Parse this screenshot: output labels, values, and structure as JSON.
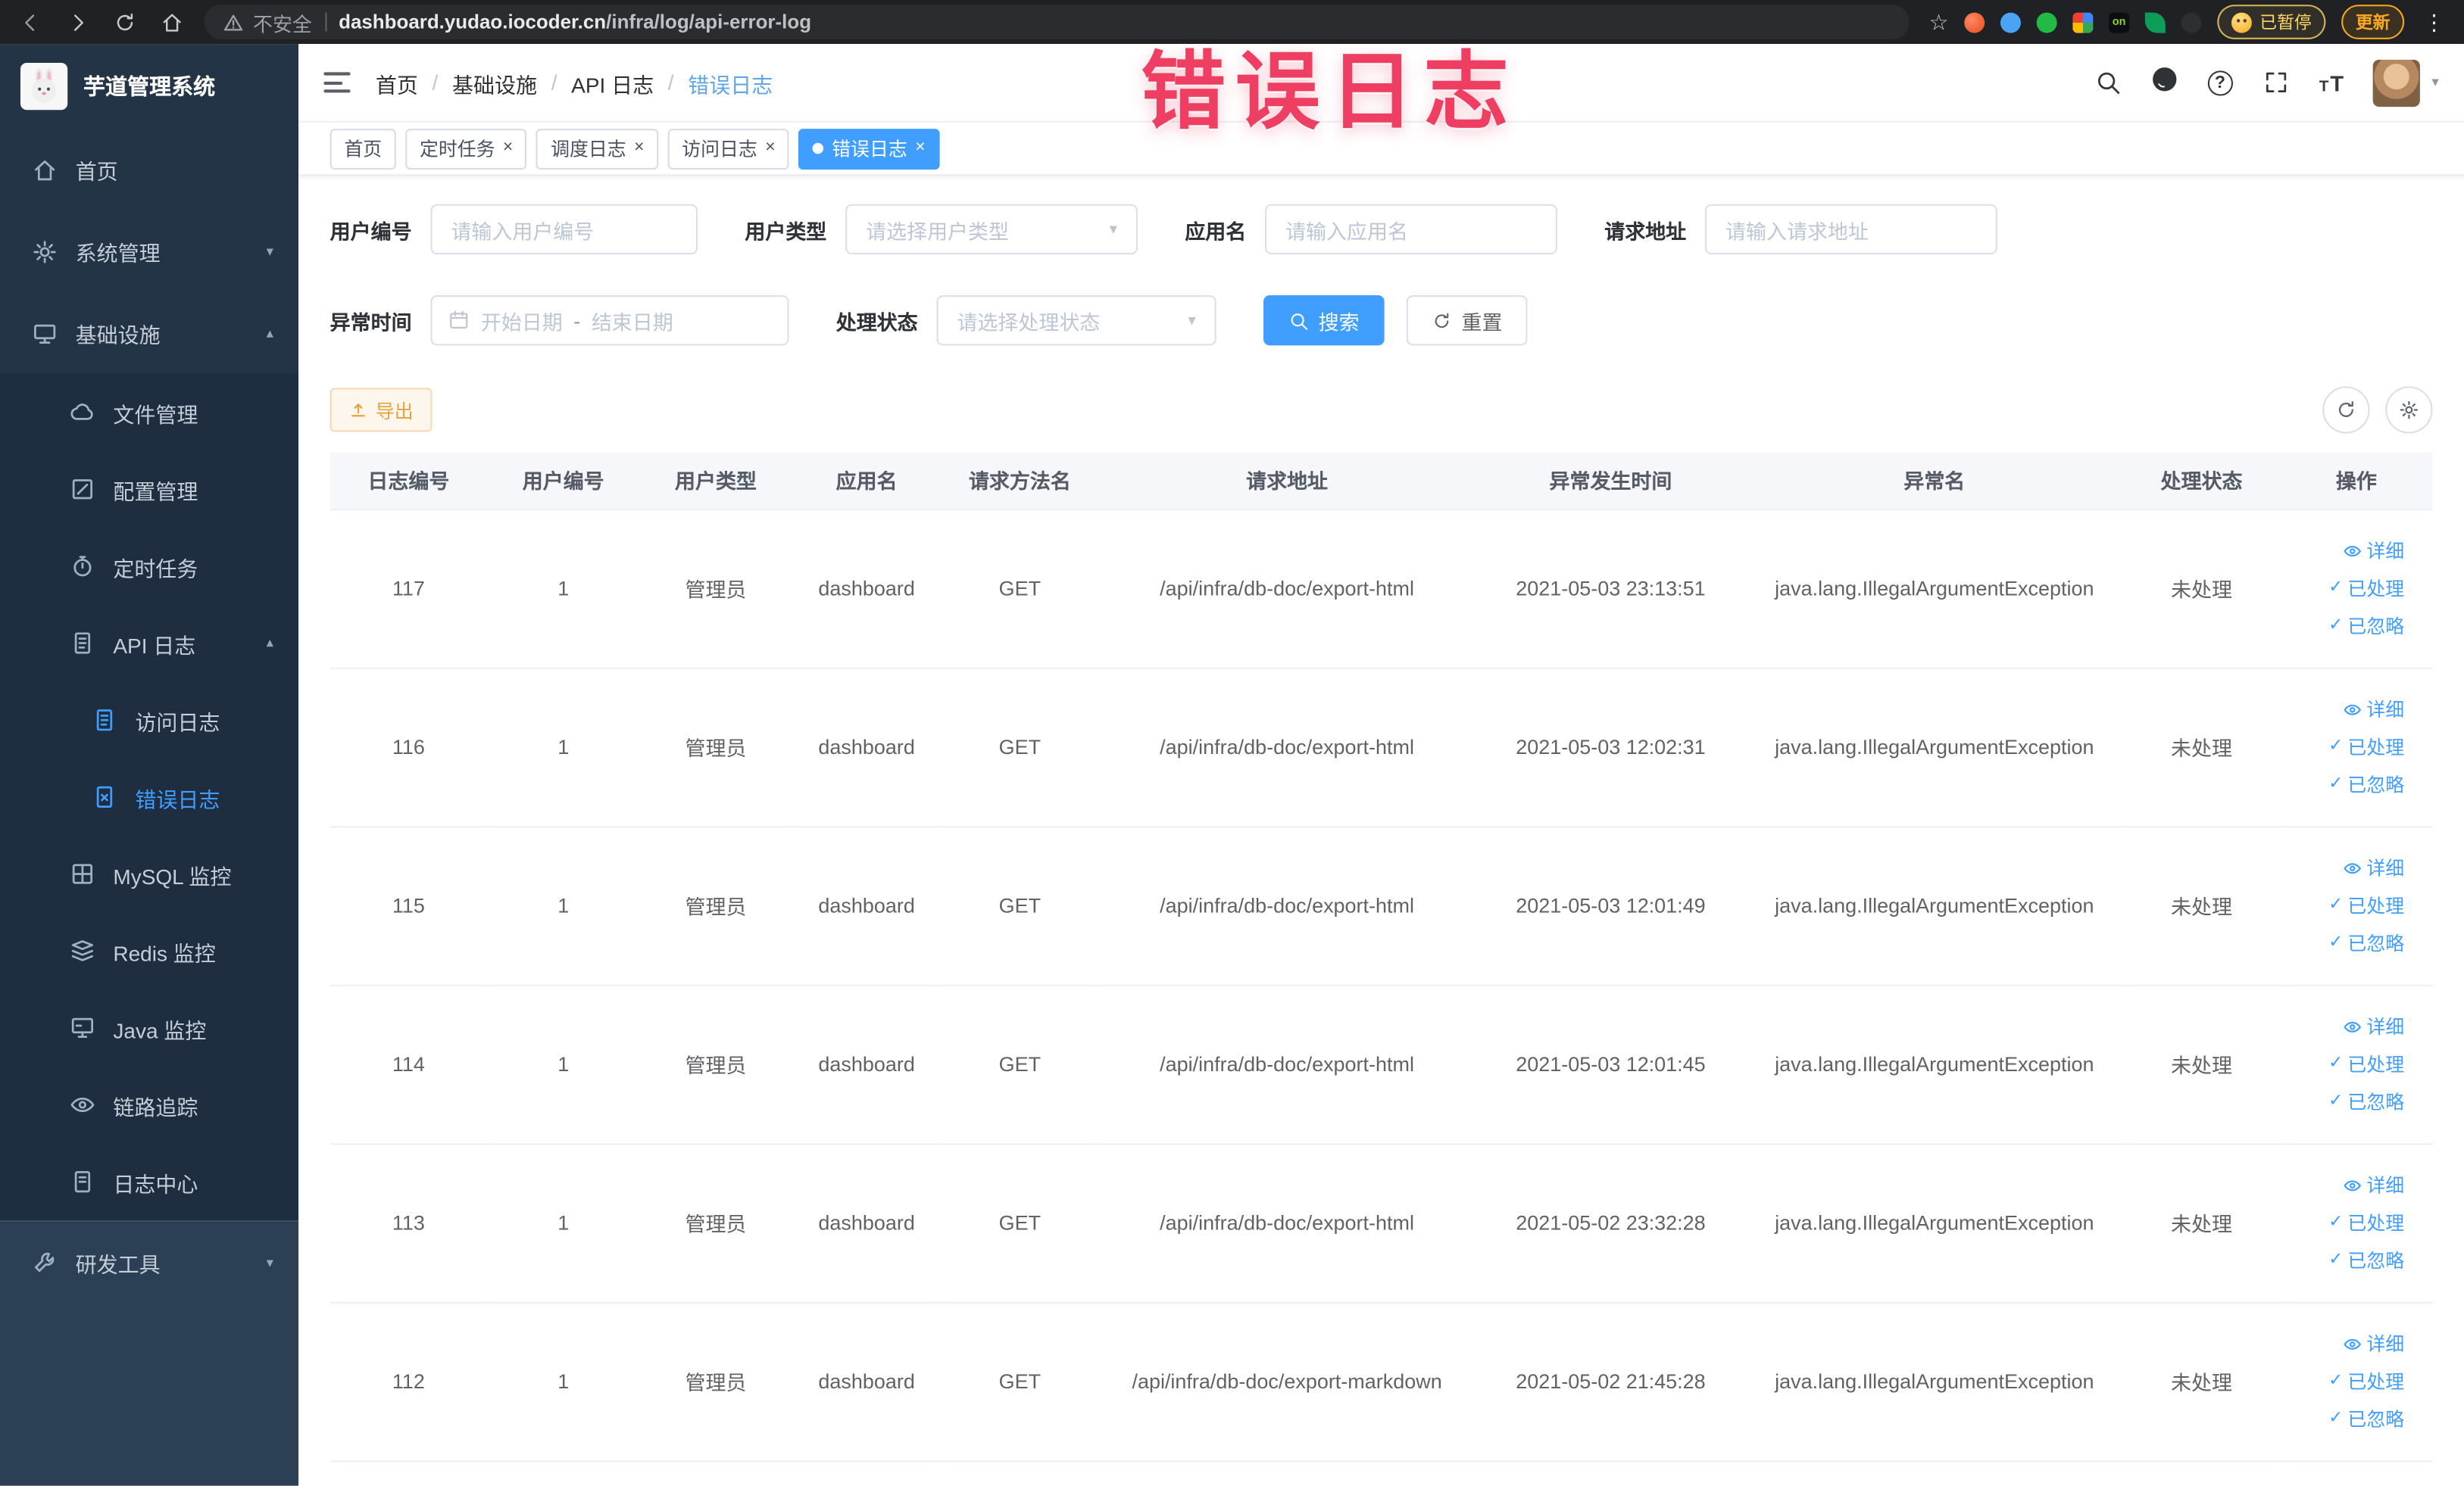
{
  "watermark": "错误日志",
  "browser": {
    "security_label": "不安全",
    "url_domain": "dashboard.yudao.iocoder.cn",
    "url_path": "/infra/log/api-error-log",
    "ext_on_label": "on",
    "paused_badge": "已暂停",
    "update_button": "更新"
  },
  "sidebar": {
    "logo_title": "芋道管理系统",
    "items": [
      {
        "label": "首页"
      },
      {
        "label": "系统管理"
      },
      {
        "label": "基础设施"
      },
      {
        "label": "文件管理"
      },
      {
        "label": "配置管理"
      },
      {
        "label": "定时任务"
      },
      {
        "label": "API 日志"
      },
      {
        "label": "访问日志"
      },
      {
        "label": "错误日志"
      },
      {
        "label": "MySQL 监控"
      },
      {
        "label": "Redis 监控"
      },
      {
        "label": "Java 监控"
      },
      {
        "label": "链路追踪"
      },
      {
        "label": "日志中心"
      },
      {
        "label": "研发工具"
      }
    ]
  },
  "breadcrumb": {
    "separator": "/",
    "items": [
      "首页",
      "基础设施",
      "API 日志",
      "错误日志"
    ]
  },
  "tabs": [
    {
      "label": "首页"
    },
    {
      "label": "定时任务"
    },
    {
      "label": "调度日志"
    },
    {
      "label": "访问日志"
    },
    {
      "label": "错误日志"
    }
  ],
  "filters": {
    "user_id_label": "用户编号",
    "user_id_placeholder": "请输入用户编号",
    "user_type_label": "用户类型",
    "user_type_placeholder": "请选择用户类型",
    "app_name_label": "应用名",
    "app_name_placeholder": "请输入应用名",
    "request_url_label": "请求地址",
    "request_url_placeholder": "请输入请求地址",
    "exception_time_label": "异常时间",
    "date_start_placeholder": "开始日期",
    "date_separator": "-",
    "date_end_placeholder": "结束日期",
    "process_status_label": "处理状态",
    "process_status_placeholder": "请选择处理状态",
    "search_button": "搜索",
    "reset_button": "重置"
  },
  "toolbar": {
    "export_label": "导出"
  },
  "table": {
    "columns": [
      "日志编号",
      "用户编号",
      "用户类型",
      "应用名",
      "请求方法名",
      "请求地址",
      "异常发生时间",
      "异常名",
      "处理状态",
      "操作"
    ],
    "action_labels": {
      "detail": "详细",
      "processed": "已处理",
      "ignored": "已忽略"
    },
    "rows": [
      {
        "id": "117",
        "user_id": "1",
        "user_type": "管理员",
        "app": "dashboard",
        "method": "GET",
        "url": "/api/infra/db-doc/export-html",
        "time": "2021-05-03 23:13:51",
        "exception": "java.lang.IllegalArgumentException",
        "status": "未处理"
      },
      {
        "id": "116",
        "user_id": "1",
        "user_type": "管理员",
        "app": "dashboard",
        "method": "GET",
        "url": "/api/infra/db-doc/export-html",
        "time": "2021-05-03 12:02:31",
        "exception": "java.lang.IllegalArgumentException",
        "status": "未处理"
      },
      {
        "id": "115",
        "user_id": "1",
        "user_type": "管理员",
        "app": "dashboard",
        "method": "GET",
        "url": "/api/infra/db-doc/export-html",
        "time": "2021-05-03 12:01:49",
        "exception": "java.lang.IllegalArgumentException",
        "status": "未处理"
      },
      {
        "id": "114",
        "user_id": "1",
        "user_type": "管理员",
        "app": "dashboard",
        "method": "GET",
        "url": "/api/infra/db-doc/export-html",
        "time": "2021-05-03 12:01:45",
        "exception": "java.lang.IllegalArgumentException",
        "status": "未处理"
      },
      {
        "id": "113",
        "user_id": "1",
        "user_type": "管理员",
        "app": "dashboard",
        "method": "GET",
        "url": "/api/infra/db-doc/export-html",
        "time": "2021-05-02 23:32:28",
        "exception": "java.lang.IllegalArgumentException",
        "status": "未处理"
      },
      {
        "id": "112",
        "user_id": "1",
        "user_type": "管理员",
        "app": "dashboard",
        "method": "GET",
        "url": "/api/infra/db-doc/export-markdown",
        "time": "2021-05-02 21:45:28",
        "exception": "java.lang.IllegalArgumentException",
        "status": "未处理"
      }
    ]
  },
  "colors": {
    "accent": "#409eff",
    "warning": "#e6a23c",
    "watermark_red": "#ee3f63",
    "sidebar_bg": "#243447",
    "browser_bg": "#202124"
  }
}
